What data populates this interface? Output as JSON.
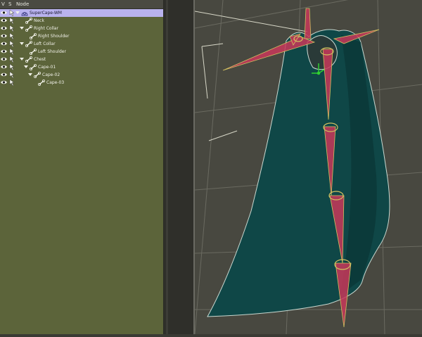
{
  "tree": {
    "columns": {
      "v": "V",
      "s": "S",
      "node": "Node"
    },
    "nodes": [
      {
        "label": "SuperCape-WM",
        "indent": 0,
        "toggle": "down",
        "icon": "figure-icon",
        "selected": true
      },
      {
        "label": "Neck",
        "indent": 1,
        "toggle": "none",
        "icon": "bone-icon",
        "selected": false
      },
      {
        "label": "Right Collar",
        "indent": 1,
        "toggle": "down",
        "icon": "bone-icon",
        "selected": false
      },
      {
        "label": "Right Shoulder",
        "indent": 2,
        "toggle": "none",
        "icon": "bone-icon",
        "selected": false
      },
      {
        "label": "Left Collar",
        "indent": 1,
        "toggle": "down",
        "icon": "bone-icon",
        "selected": false
      },
      {
        "label": "Left Shoulder",
        "indent": 2,
        "toggle": "none",
        "icon": "bone-icon",
        "selected": false
      },
      {
        "label": "Chest",
        "indent": 1,
        "toggle": "down",
        "icon": "bone-icon",
        "selected": false
      },
      {
        "label": "Cape-01",
        "indent": 2,
        "toggle": "down",
        "icon": "bone-icon",
        "selected": false
      },
      {
        "label": "Cape-02",
        "indent": 3,
        "toggle": "down",
        "icon": "bone-icon",
        "selected": false
      },
      {
        "label": "Cape-03",
        "indent": 4,
        "toggle": "none",
        "icon": "bone-icon",
        "selected": false
      }
    ]
  },
  "icons": {
    "visibility": "eye-icon",
    "selectable": "cursor-icon",
    "expand": "triangle-down-icon"
  },
  "colors": {
    "panel_bg": "#5c643a",
    "selected_row": "#b9b2ee",
    "viewport_bg": "#484840",
    "cape": "#0f4a4a",
    "bone": "#c8385a"
  }
}
